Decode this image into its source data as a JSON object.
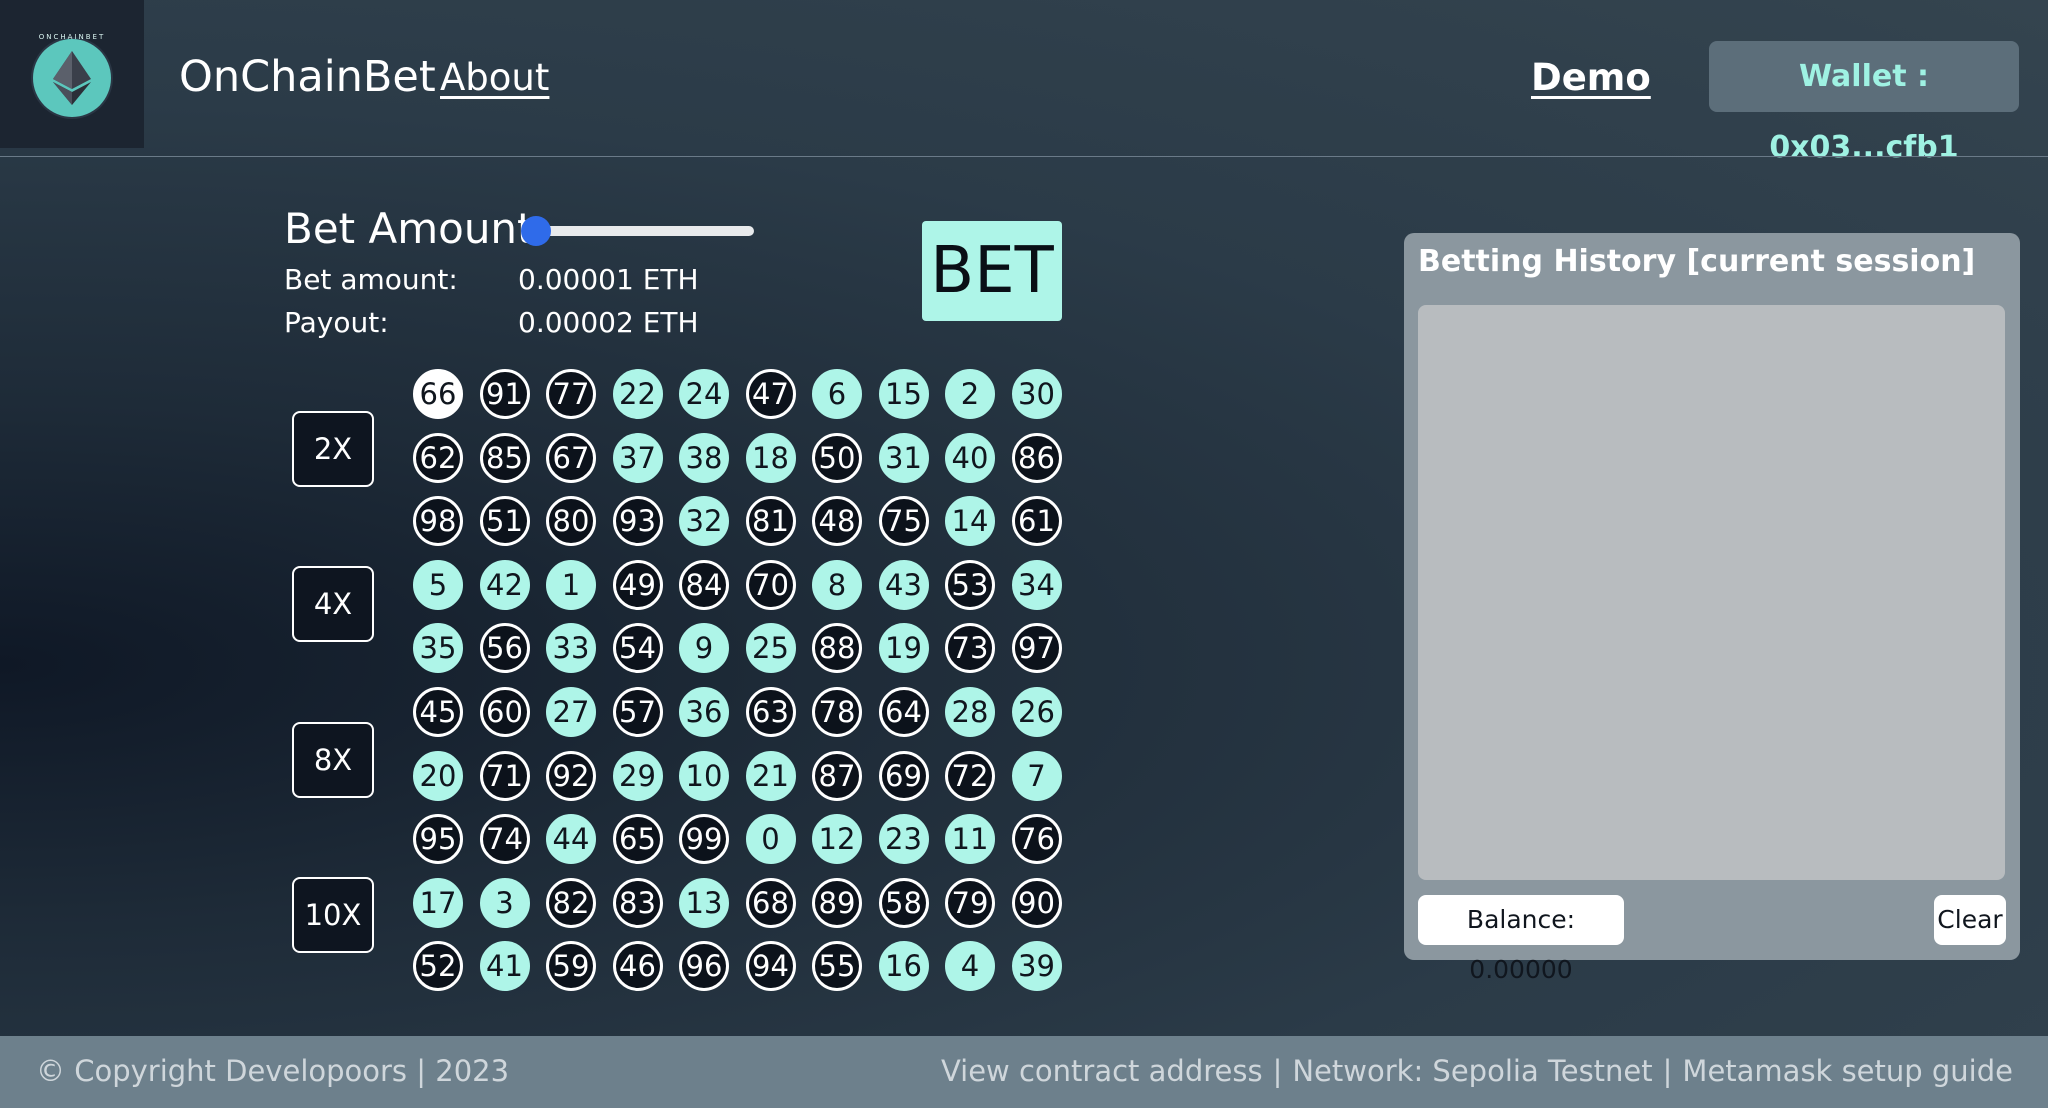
{
  "header": {
    "logo_ring_text": "ONCHAINBET",
    "brand": "OnChainBet",
    "about_label": "About",
    "demo_label": "Demo",
    "wallet_label": "Wallet : 0x03...cfb1"
  },
  "bet": {
    "title": "Bet Amount",
    "slider_value_fraction": 0.0,
    "amount_label": "Bet amount:",
    "amount_value": "0.00001 ETH",
    "payout_label": "Payout:",
    "payout_value": "0.00002 ETH",
    "bet_button": "BET",
    "multipliers": [
      "2X",
      "4X",
      "8X",
      "10X"
    ]
  },
  "grid": {
    "rows": [
      [
        66,
        91,
        77,
        22,
        24,
        47,
        6,
        15,
        2,
        30
      ],
      [
        62,
        85,
        67,
        37,
        38,
        18,
        50,
        31,
        40,
        86
      ],
      [
        98,
        51,
        80,
        93,
        32,
        81,
        48,
        75,
        14,
        61
      ],
      [
        5,
        42,
        1,
        49,
        84,
        70,
        8,
        43,
        53,
        34
      ],
      [
        35,
        56,
        33,
        54,
        9,
        25,
        88,
        19,
        73,
        97
      ],
      [
        45,
        60,
        27,
        57,
        36,
        63,
        78,
        64,
        28,
        26
      ],
      [
        20,
        71,
        92,
        29,
        10,
        21,
        87,
        69,
        72,
        7
      ],
      [
        95,
        74,
        44,
        65,
        99,
        0,
        12,
        23,
        11,
        76
      ],
      [
        17,
        3,
        82,
        83,
        13,
        68,
        89,
        58,
        79,
        90
      ],
      [
        52,
        41,
        59,
        46,
        96,
        94,
        55,
        16,
        4,
        39
      ]
    ],
    "highlighted": [
      0,
      1,
      2,
      3,
      4,
      5,
      6,
      7,
      8,
      9,
      10,
      11,
      12,
      13,
      14,
      15,
      16,
      17,
      18,
      19,
      20,
      21,
      22,
      23,
      24,
      25,
      26,
      27,
      28,
      29,
      30,
      31,
      32,
      33,
      34,
      35,
      36,
      37,
      38,
      39,
      40,
      41,
      42,
      43,
      44
    ],
    "selected": 66,
    "colors": {
      "teal": "#aef5e8",
      "dark": "#0c121b",
      "selected": "#ffffff"
    }
  },
  "history": {
    "title": "Betting History [current session]",
    "balance": "Balance: 0.00000",
    "clear_label": "Clear"
  },
  "footer": {
    "copyright": "© Copyright Developoors | 2023",
    "contract_link": "View contract address",
    "network": "Network: Sepolia Testnet",
    "metamask_link": "Metamask setup guide"
  }
}
